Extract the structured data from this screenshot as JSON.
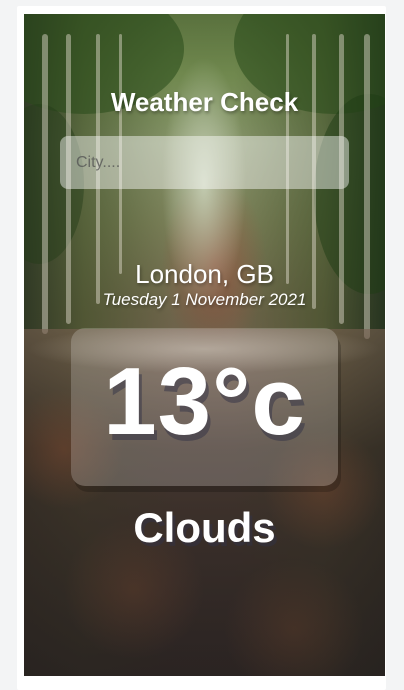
{
  "app": {
    "title": "Weather Check"
  },
  "search": {
    "placeholder": "City....",
    "value": ""
  },
  "location": {
    "city": "London, GB",
    "date": "Tuesday 1 November 2021"
  },
  "weather": {
    "temperature": "13°c",
    "condition": "Clouds"
  },
  "colors": {
    "text": "#ffffff",
    "page_background": "#f3f4f5"
  },
  "background_image": "forest-road-autumn"
}
